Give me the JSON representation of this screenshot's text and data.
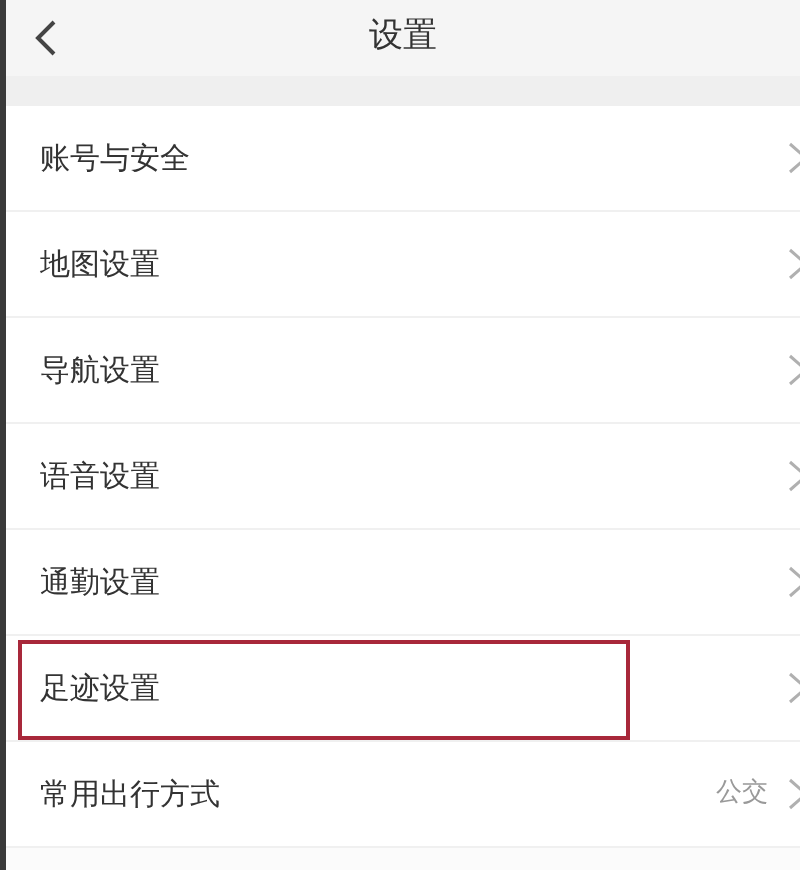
{
  "header": {
    "title": "设置"
  },
  "items": [
    {
      "label": "账号与安全",
      "highlighted": false
    },
    {
      "label": "地图设置",
      "highlighted": false
    },
    {
      "label": "导航设置",
      "highlighted": false
    },
    {
      "label": "语音设置",
      "highlighted": false
    },
    {
      "label": "通勤设置",
      "highlighted": false
    },
    {
      "label": "足迹设置",
      "highlighted": true
    },
    {
      "label": "常用出行方式",
      "value": "公交",
      "highlighted": false
    }
  ]
}
